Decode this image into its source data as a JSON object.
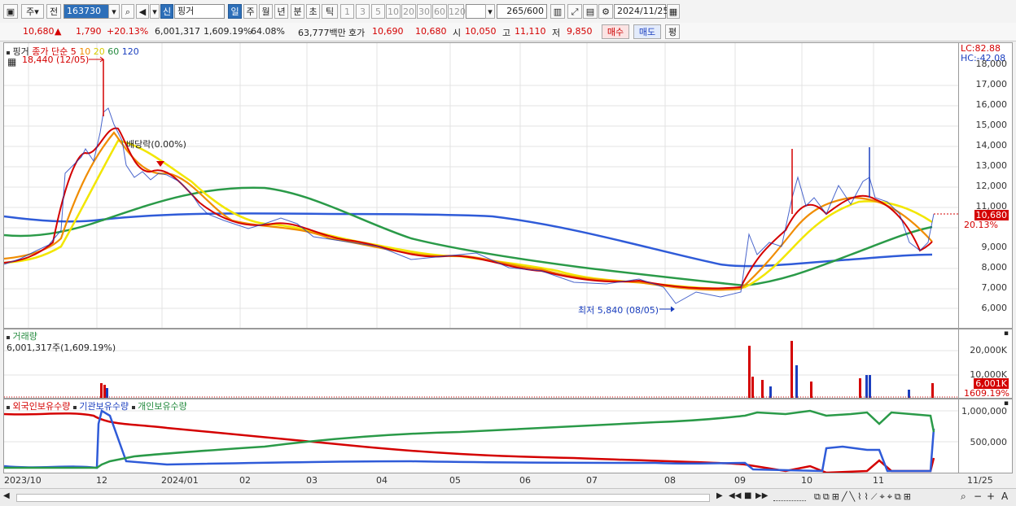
{
  "toolbar": {
    "period_main": "주",
    "prev_label": "전",
    "code": "163730",
    "name_tag": "신",
    "stock_name": "핑거",
    "periods": [
      "일",
      "주",
      "월",
      "년",
      "분",
      "초",
      "틱"
    ],
    "period_selected": "일",
    "intervals": [
      "1",
      "3",
      "5",
      "10",
      "20",
      "30",
      "60",
      "120"
    ],
    "count": "265",
    "total": "/600",
    "date": "2024/11/25"
  },
  "quote": {
    "price": "10,680",
    "arrow": "▲",
    "change": "1,790",
    "pct": "+20.13%",
    "volume": "6,001,317",
    "vol_pct": "1,609.19%",
    "turnover": "64.08%",
    "value": "63,777백만",
    "hoga_label": "호가",
    "ask": "10,690",
    "bid": "10,680",
    "open_label": "시",
    "open": "10,050",
    "high_label": "고",
    "high": "11,110",
    "low_label": "저",
    "low": "9,850",
    "buy_label": "매수",
    "sell_label": "매도",
    "eval_label": "평"
  },
  "main_panel": {
    "stock_label": "핑거",
    "ma_label": "종가 단순",
    "ma_periods": [
      "5",
      "10",
      "20",
      "60",
      "120"
    ],
    "high_annot": "18,440 (12/05)",
    "dividend_annot": "배당락(0.00%)",
    "low_annot": "최저 5,840 (08/05)",
    "lc": "LC:82.88",
    "hc": "HC:-42.08",
    "y_ticks": [
      "18,000",
      "17,000",
      "16,000",
      "15,000",
      "14,000",
      "13,000",
      "12,000",
      "11,000",
      "10,000",
      "9,000",
      "8,000",
      "7,000",
      "6,000"
    ],
    "price_badge": "10,680",
    "pct_badge": "20.13%"
  },
  "volume_panel": {
    "title": "거래량",
    "value": "6,001,317주(1,609.19%)",
    "y_ticks": [
      "20,000K",
      "10,000K"
    ],
    "vol_badge": "6,001K",
    "pct_badge": "1609.19%"
  },
  "holding_panel": {
    "series": [
      "외국인보유수량",
      "기관보유수량",
      "개인보유수량"
    ],
    "y_ticks": [
      "1,000,000",
      "500,000"
    ]
  },
  "x_axis": [
    "2023/10",
    "12",
    "2024/01",
    "02",
    "03",
    "04",
    "05",
    "06",
    "07",
    "08",
    "09",
    "10",
    "11",
    "11/25"
  ],
  "colors": {
    "up": "#d40000",
    "down": "#1b3fbf",
    "ma5": "#d40000",
    "ma10": "#f08c00",
    "ma20": "#f2e600",
    "ma60": "#2a9a48",
    "ma120": "#2f5bd8"
  }
}
